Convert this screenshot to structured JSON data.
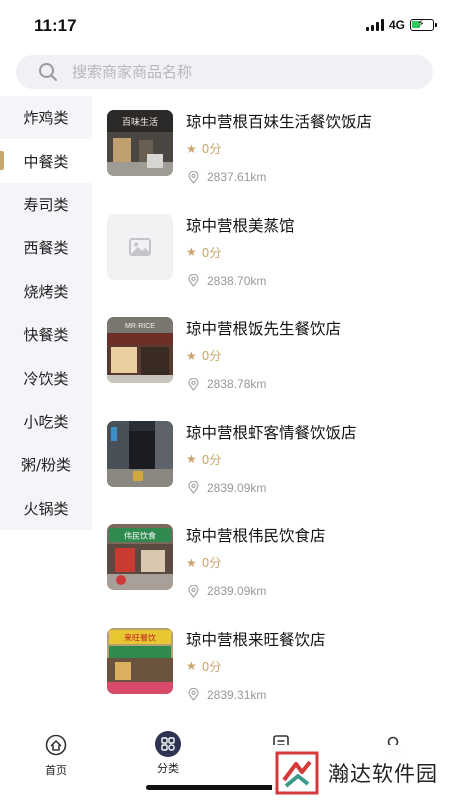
{
  "status_bar": {
    "time": "11:17",
    "network": "4G"
  },
  "search": {
    "placeholder": "搜索商家商品名称"
  },
  "categories": [
    {
      "label": "炸鸡类"
    },
    {
      "label": "中餐类",
      "active": true
    },
    {
      "label": "寿司类"
    },
    {
      "label": "西餐类"
    },
    {
      "label": "烧烤类"
    },
    {
      "label": "快餐类"
    },
    {
      "label": "冷饮类"
    },
    {
      "label": "小吃类"
    },
    {
      "label": "粥/粉类"
    },
    {
      "label": "火锅类"
    }
  ],
  "stores": [
    {
      "name": "琼中营根百妹生活餐饮饭店",
      "rating": "0分",
      "distance": "2837.61km",
      "thumb_sign": "百味生活"
    },
    {
      "name": "琼中营根美蒸馆",
      "rating": "0分",
      "distance": "2838.70km",
      "thumb_sign": ""
    },
    {
      "name": "琼中营根饭先生餐饮店",
      "rating": "0分",
      "distance": "2838.78km",
      "thumb_sign": "MR·RICE"
    },
    {
      "name": "琼中营根虾客情餐饮饭店",
      "rating": "0分",
      "distance": "2839.09km",
      "thumb_sign": ""
    },
    {
      "name": "琼中营根伟民饮食店",
      "rating": "0分",
      "distance": "2839.09km",
      "thumb_sign": "伟民饮食"
    },
    {
      "name": "琼中营根来旺餐饮店",
      "rating": "0分",
      "distance": "2839.31km",
      "thumb_sign": "来旺餐饮"
    }
  ],
  "tabs": [
    {
      "label": "首页",
      "icon": "home-icon"
    },
    {
      "label": "分类",
      "icon": "category-icon",
      "active": true
    },
    {
      "label": "",
      "icon": "orders-icon"
    },
    {
      "label": "",
      "icon": "profile-icon"
    }
  ],
  "watermark": {
    "text": "瀚达软件园"
  },
  "colors": {
    "accent": "#c9a66b",
    "active_tab": "#2d3550",
    "sidebar_bg": "#f5f4f8"
  }
}
